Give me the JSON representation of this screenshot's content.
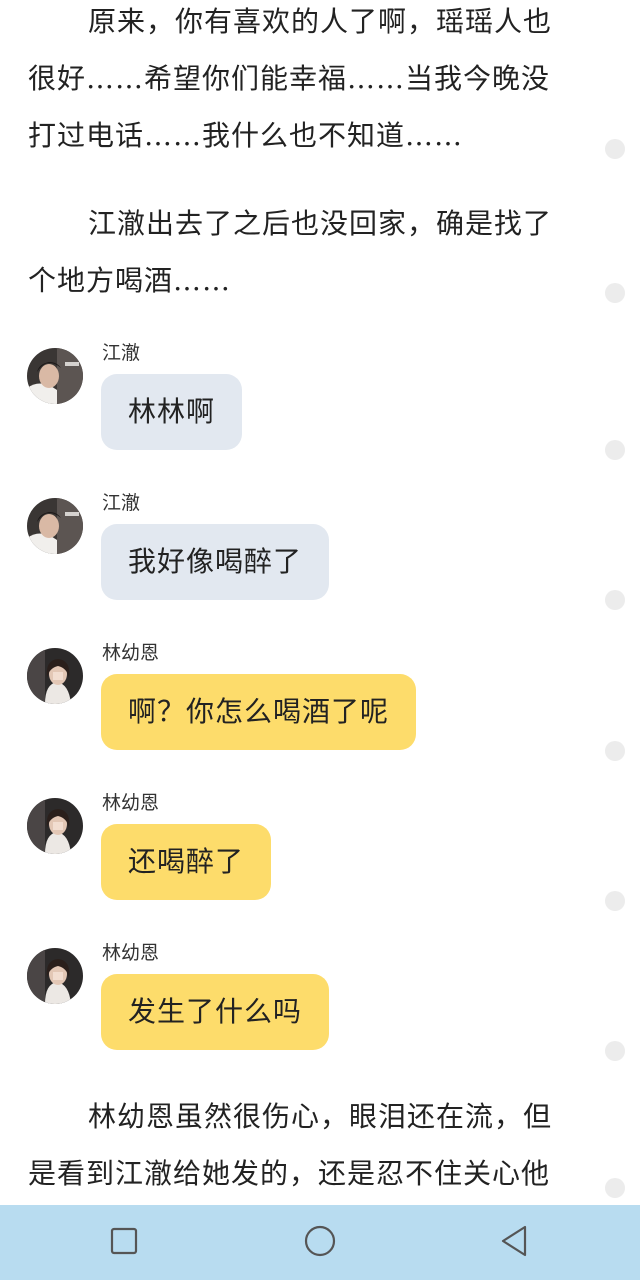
{
  "story": {
    "para1": {
      "lines": [
        "原来，你有喜欢的人了啊，瑶瑶人也",
        "很好……希望你们能幸福……当我今晚没",
        "打过电话……我什么也不知道……"
      ]
    },
    "para2": {
      "lines": [
        "江澈出去了之后也没回家，确是找了",
        "个地方喝酒……"
      ]
    },
    "para3": {
      "lines": [
        "林幼恩虽然很伤心，眼泪还在流，但",
        "是看到江澈给她发的，还是忍不住关心他"
      ]
    }
  },
  "chat": {
    "messages": [
      {
        "sender": "江澈",
        "text": "林林啊",
        "color": "#e2e8f0"
      },
      {
        "sender": "江澈",
        "text": "我好像喝醉了",
        "color": "#e2e8f0"
      },
      {
        "sender": "林幼恩",
        "text": "啊？你怎么喝酒了呢",
        "color": "#fddc6b"
      },
      {
        "sender": "林幼恩",
        "text": "还喝醉了",
        "color": "#fddc6b"
      },
      {
        "sender": "林幼恩",
        "text": "发生了什么吗",
        "color": "#fddc6b"
      }
    ]
  },
  "navbar": {
    "background": "#b8dcf0",
    "icons": [
      "recent-apps-icon",
      "home-icon",
      "back-icon"
    ]
  }
}
